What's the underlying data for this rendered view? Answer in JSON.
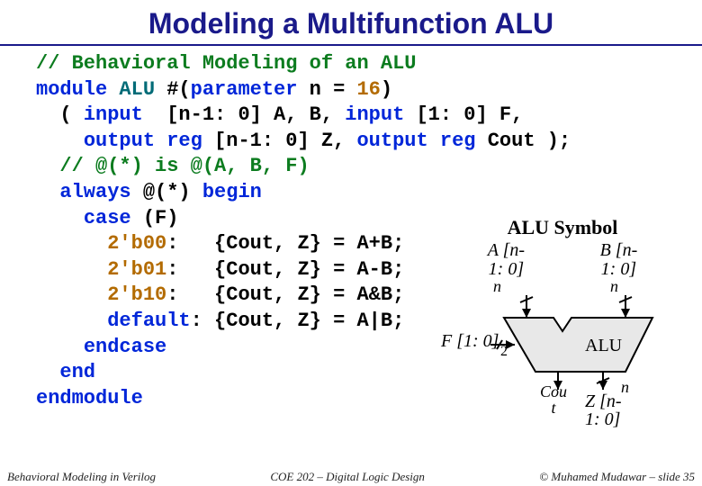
{
  "title": "Modeling a Multifunction ALU",
  "code": {
    "cmt": "// Behavioral Modeling of an ALU",
    "l2a": "module",
    "l2b": "ALU",
    "l2c": "#(",
    "l2d": "parameter",
    "l2e": "n = ",
    "l2f": "16",
    "l2g": ")",
    "l3a": "  ( ",
    "l3b": "input",
    "l3c": "  [n-1: 0] A, B, ",
    "l3d": "input",
    "l3e": " [1: 0] F,",
    "l4a": "    ",
    "l4b": "output reg",
    "l4c": " [n-1: 0] Z, ",
    "l4d": "output reg",
    "l4e": " Cout );",
    "l5": "  // @(*) is @(A, B, F)",
    "l6a": "  ",
    "l6b": "always",
    "l6c": " @(*) ",
    "l6d": "begin",
    "l7a": "    ",
    "l7b": "case",
    "l7c": " (F)",
    "l8a": "      ",
    "l8b": "2'b00",
    "l8c": ":   {Cout, Z} = A+B;",
    "l9a": "      ",
    "l9b": "2'b01",
    "l9c": ":   {Cout, Z} = A-B;",
    "l10a": "      ",
    "l10b": "2'b10",
    "l10c": ":   {Cout, Z} = A&B;",
    "l11a": "      ",
    "l11b": "default",
    "l11c": ": {Cout, Z} = A|B;",
    "l12a": "    ",
    "l12b": "endcase",
    "l13a": "  ",
    "l13b": "end",
    "l14": "endmodule"
  },
  "diagram": {
    "heading": "ALU Symbol",
    "A": "A [n-\n1: 0]",
    "B": "B [n-\n1: 0]",
    "nL": "n",
    "nR": "n",
    "F": "F [1: 0]",
    "two": "2",
    "alu": "ALU",
    "cout": "Cou\nt",
    "nOut": "n",
    "Z": "Z [n-\n1: 0]"
  },
  "footer": {
    "left": "Behavioral Modeling in Verilog",
    "center": "COE 202 – Digital Logic Design",
    "right": "© Muhamed Mudawar – slide 35"
  }
}
